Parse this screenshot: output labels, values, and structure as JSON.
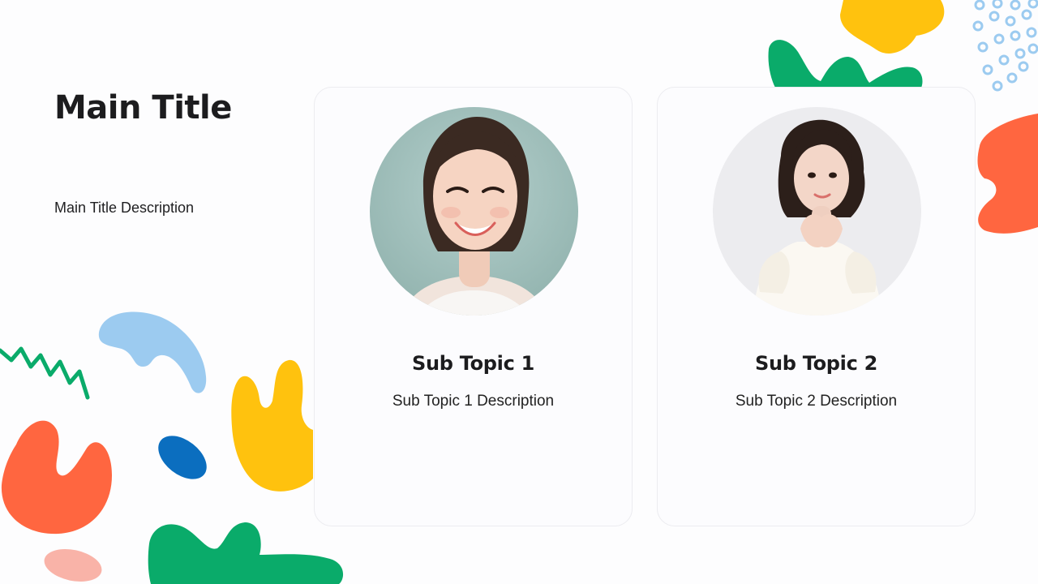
{
  "slide": {
    "title": "Main Title",
    "description": "Main Title Description"
  },
  "cards": [
    {
      "title": "Sub Topic 1",
      "description": "Sub Topic 1 Description",
      "photo": "portrait-photo-smiling-woman"
    },
    {
      "title": "Sub Topic 2",
      "description": "Sub Topic 2 Description",
      "photo": "portrait-photo-woman-hands-at-chin"
    }
  ],
  "colors": {
    "background": "#fdfdfe",
    "orange": "#ff6640",
    "yellow": "#ffc20e",
    "green": "#0aab6a",
    "light_blue": "#9ccbf0",
    "blue": "#0b6ebf",
    "pink": "#f9b3a8"
  }
}
